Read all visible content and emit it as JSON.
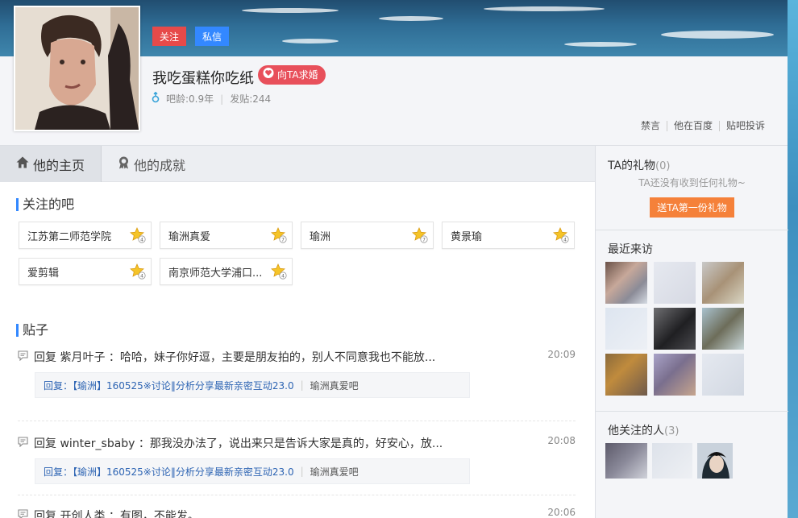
{
  "header": {
    "follow_label": "关注",
    "message_label": "私信",
    "username": "我吃蛋糕你吃纸",
    "propose_label": "向TA求婚",
    "bar_age": "吧龄:0.9年",
    "post_count": "发贴:244",
    "links": [
      "禁言",
      "他在百度",
      "贴吧投诉"
    ]
  },
  "tabs": [
    {
      "label": "他的主页",
      "icon": "home-icon",
      "active": true
    },
    {
      "label": "他的成就",
      "icon": "medal-icon",
      "active": false
    }
  ],
  "followed_bars": {
    "title": "关注的吧",
    "items": [
      {
        "name": "江苏第二师范学院",
        "badge": "star-level-icon"
      },
      {
        "name": "瑜洲真爱",
        "badge": "star-level-icon"
      },
      {
        "name": "瑜洲",
        "badge": "star-level-icon"
      },
      {
        "name": "黄景瑜",
        "badge": "star-level-icon"
      },
      {
        "name": "爱剪辑",
        "badge": "star-level-icon"
      },
      {
        "name": "南京师范大学浦口...",
        "badge": "star-level-icon"
      }
    ]
  },
  "posts": {
    "title": "贴子",
    "items": [
      {
        "text": "回复 紫月叶子 ：哈哈，妹子你好逗，主要是朋友拍的，别人不同意我也不能放...",
        "time": "20:09",
        "quote": "回复：【瑜洲】160525※讨论‖分析分享最新亲密互动23.0",
        "bar": "瑜洲真爱吧"
      },
      {
        "text": "回复 winter_sbaby ：那我没办法了，说出来只是告诉大家是真的，好安心，放...",
        "time": "20:08",
        "quote": "回复：【瑜洲】160525※讨论‖分析分享最新亲密互动23.0",
        "bar": "瑜洲真爱吧"
      },
      {
        "text": "回复 开创人类 ：有图，不能发。",
        "time": "20:06",
        "quote": "",
        "bar": ""
      }
    ]
  },
  "sidebar": {
    "gift_title": "TA的礼物",
    "gift_count": "(0)",
    "gift_note": "TA还没有收到任何礼物~",
    "gift_button": "送TA第一份礼物",
    "visitors_title": "最近来访",
    "following_title": "他关注的人",
    "following_count": "(3)"
  },
  "colors": {
    "follow": "#e64a4a",
    "message": "#3388ff",
    "propose": "#e8505b",
    "gift_button": "#f5813a",
    "link": "#2d64b3"
  }
}
